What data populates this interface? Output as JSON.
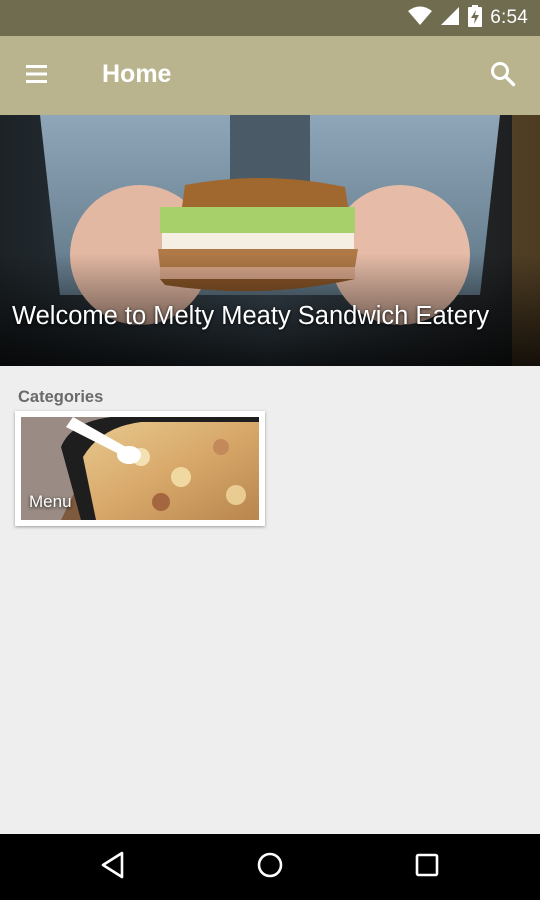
{
  "status_bar": {
    "time": "6:54",
    "wifi_icon": "wifi-icon",
    "signal_icon": "signal-icon",
    "battery_icon": "battery-charging-icon"
  },
  "app_bar": {
    "title": "Home",
    "menu_icon": "hamburger-menu-icon",
    "search_icon": "search-icon",
    "color": "#b9b48e"
  },
  "hero": {
    "title": "Welcome to Melty Meaty Sandwich Eatery"
  },
  "categories": {
    "label": "Categories",
    "items": [
      {
        "label": "Menu"
      }
    ]
  },
  "nav_bar": {
    "back_icon": "back-triangle-icon",
    "home_icon": "home-circle-icon",
    "recents_icon": "recents-square-icon"
  }
}
